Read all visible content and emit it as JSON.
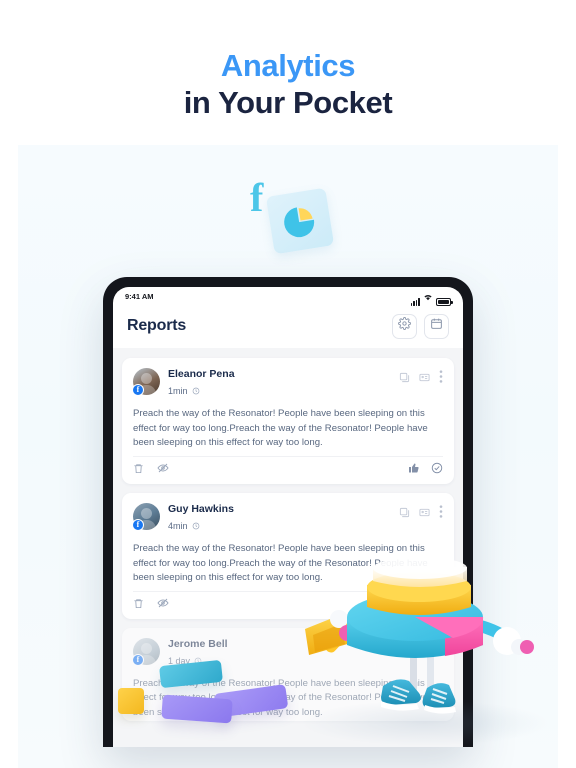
{
  "headline": {
    "line1": "Analytics",
    "line2": "in Your Pocket",
    "accent_color": "#3b97f6",
    "dark_color": "#1b2440"
  },
  "float_icons": {
    "facebook_glyph": "f",
    "facebook_color": "#4cc6e8",
    "chart_card_icon": "pie-chart",
    "pie_colors": [
      "#3fc3e8",
      "#ffd65a"
    ]
  },
  "device": {
    "statusbar": {
      "time": "9:41 AM",
      "icons": [
        "cellular-signal",
        "wifi",
        "battery"
      ]
    },
    "header": {
      "title": "Reports",
      "actions": [
        {
          "name": "settings",
          "icon": "gear-icon"
        },
        {
          "name": "calendar",
          "icon": "calendar-icon"
        }
      ]
    }
  },
  "feed": {
    "post_body": "Preach the way of the Resonator! People have been sleeping on this effect for way too long.Preach the way of the Resonator! People have been sleeping on this effect for way too long.",
    "cards": [
      {
        "author": "Eleanor Pena",
        "time": "1min",
        "source": "facebook",
        "badge_glyph": "f",
        "top_icons": [
          "image-stack-icon",
          "media-card-icon",
          "more-vertical-icon"
        ],
        "foot_left_icons": [
          "trash-icon",
          "eye-slash-icon"
        ],
        "foot_right_icons": [
          "thumbs-up-icon",
          "check-circle-icon"
        ],
        "faded": false
      },
      {
        "author": "Guy Hawkins",
        "time": "4min",
        "source": "facebook",
        "badge_glyph": "f",
        "top_icons": [
          "image-stack-icon",
          "media-card-icon",
          "more-vertical-icon"
        ],
        "foot_left_icons": [
          "trash-icon",
          "eye-slash-icon"
        ],
        "foot_right_icons": [],
        "faded": false
      },
      {
        "author": "Jerome Bell",
        "time": "1 day",
        "source": "facebook",
        "badge_glyph": "f",
        "top_icons": [
          "image-stack-icon",
          "media-card-icon",
          "more-vertical-icon"
        ],
        "foot_left_icons": [],
        "foot_right_icons": [],
        "faded": true
      }
    ]
  },
  "decorations": {
    "character": "3d-chart-mascot",
    "character_parts": [
      "glass-disc",
      "yellow-bar-disc",
      "cyan-pink-pie-disc",
      "white-gloves",
      "yellow-megaphone",
      "blue-sneakers"
    ],
    "blocks": [
      "yellow-cube",
      "cyan-bar",
      "purple-bar",
      "purple-bar"
    ],
    "palette": {
      "cyan": "#3fc3e8",
      "pink": "#ff5fb0",
      "yellow": "#ffc629",
      "purple": "#9b8af3"
    }
  }
}
